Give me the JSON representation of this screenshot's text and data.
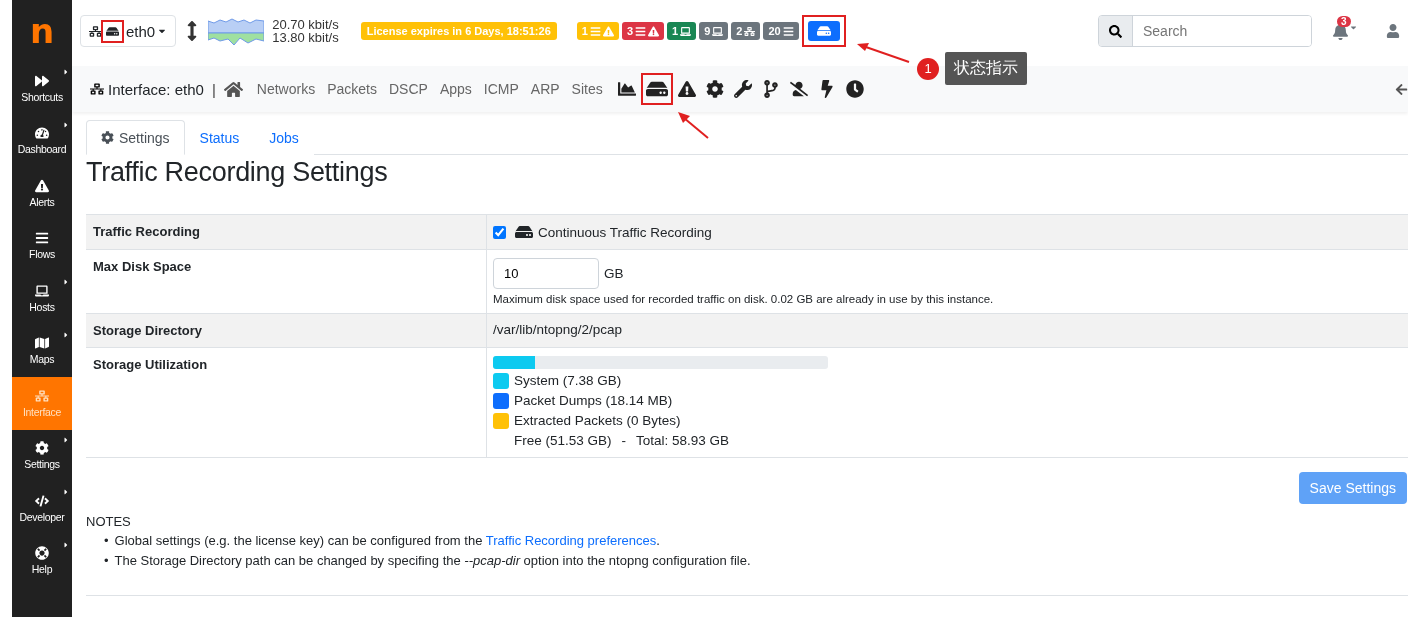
{
  "logo": "n",
  "sidebar": {
    "items": [
      {
        "label": "Shortcuts",
        "kind": "shortcuts",
        "submenu": true,
        "selected": false
      },
      {
        "label": "Dashboard",
        "kind": "dashboard",
        "submenu": true,
        "selected": false
      },
      {
        "label": "Alerts",
        "kind": "alerts",
        "submenu": false,
        "selected": false
      },
      {
        "label": "Flows",
        "kind": "flows",
        "submenu": false,
        "selected": false
      },
      {
        "label": "Hosts",
        "kind": "hosts",
        "submenu": true,
        "selected": false
      },
      {
        "label": "Maps",
        "kind": "maps",
        "submenu": true,
        "selected": false
      },
      {
        "label": "Interface",
        "kind": "interface",
        "submenu": false,
        "selected": true
      },
      {
        "label": "Settings",
        "kind": "settings",
        "submenu": true,
        "selected": false
      },
      {
        "label": "Developer",
        "kind": "developer",
        "submenu": true,
        "selected": false
      },
      {
        "label": "Help",
        "kind": "help",
        "submenu": true,
        "selected": false
      }
    ]
  },
  "topbar": {
    "interface_select": {
      "value": "eth0",
      "highlighted": true
    },
    "rates": {
      "upload": "20.70 kbit/s",
      "download": "13.80 kbit/s"
    },
    "license": "License expires in 6 Days, 18:51:26",
    "badges": [
      {
        "count": "1",
        "kind": "flowalert",
        "color": "#ffc107"
      },
      {
        "count": "3",
        "kind": "flowalert",
        "color": "#dc3545"
      },
      {
        "count": "1",
        "kind": "host",
        "color": "#198754"
      },
      {
        "count": "9",
        "kind": "host",
        "color": "#6c757d"
      },
      {
        "count": "2",
        "kind": "iface",
        "color": "#6c757d"
      },
      {
        "count": "20",
        "kind": "flow",
        "color": "#6c757d"
      },
      {
        "kind": "disk",
        "color": "#0d6efd",
        "highlighted": true
      }
    ],
    "search": {
      "placeholder": "Search"
    },
    "notifications": {
      "count": "3"
    }
  },
  "subnav": {
    "title": "Interface: eth0",
    "separator": "|",
    "links": [
      "Networks",
      "Packets",
      "DSCP",
      "Apps",
      "ICMP",
      "ARP",
      "Sites"
    ],
    "icon_buttons": [
      {
        "kind": "chart",
        "highlighted": false
      },
      {
        "kind": "disk",
        "highlighted": true
      },
      {
        "kind": "warning",
        "highlighted": false
      },
      {
        "kind": "gear",
        "highlighted": false
      },
      {
        "kind": "wrench",
        "highlighted": false
      },
      {
        "kind": "branch",
        "highlighted": false
      },
      {
        "kind": "userslash",
        "highlighted": false
      },
      {
        "kind": "bolt",
        "highlighted": false
      },
      {
        "kind": "clock",
        "highlighted": false
      }
    ]
  },
  "tabs": [
    {
      "label": "Settings",
      "selected": true
    },
    {
      "label": "Status",
      "selected": false
    },
    {
      "label": "Jobs",
      "selected": false
    }
  ],
  "heading": "Traffic Recording Settings",
  "settings": [
    {
      "kind": "checkbox",
      "label": "Traffic Recording",
      "checked": true,
      "text": "Continuous Traffic Recording"
    },
    {
      "kind": "number",
      "label": "Max Disk Space",
      "value": "10",
      "unit": "GB",
      "help": "Maximum disk space used for recorded traffic on disk. 0.02 GB are already in use by this instance."
    },
    {
      "kind": "text",
      "label": "Storage Directory",
      "text": "/var/lib/ntopng/2/pcap"
    },
    {
      "kind": "usage",
      "label": "Storage Utilization",
      "level": 0.125,
      "legend": [
        {
          "text": "System (7.38 GB)",
          "color": "#0dcaf0"
        },
        {
          "text": "Packet Dumps (18.14 MB)",
          "color": "#0d6efd"
        },
        {
          "text": "Extracted Packets (0 Bytes)",
          "color": "#ffc107"
        }
      ],
      "free": "Free (51.53 GB)",
      "total": "Total: 58.93 GB",
      "total_separator": "-"
    }
  ],
  "save_button": "Save Settings",
  "notes": {
    "title": "NOTES",
    "items": [
      {
        "marker": "•",
        "text": "Global settings (e.g. the license key) can be configured from the ",
        "link": "Traffic Recording preferences",
        "after": "."
      },
      {
        "marker": "•",
        "text": "The Storage Directory path can be changed by specifing the *--pcap-dir* option into the ntopng configuration file."
      }
    ]
  },
  "annotation": {
    "number": "1",
    "label": "状态指示"
  }
}
